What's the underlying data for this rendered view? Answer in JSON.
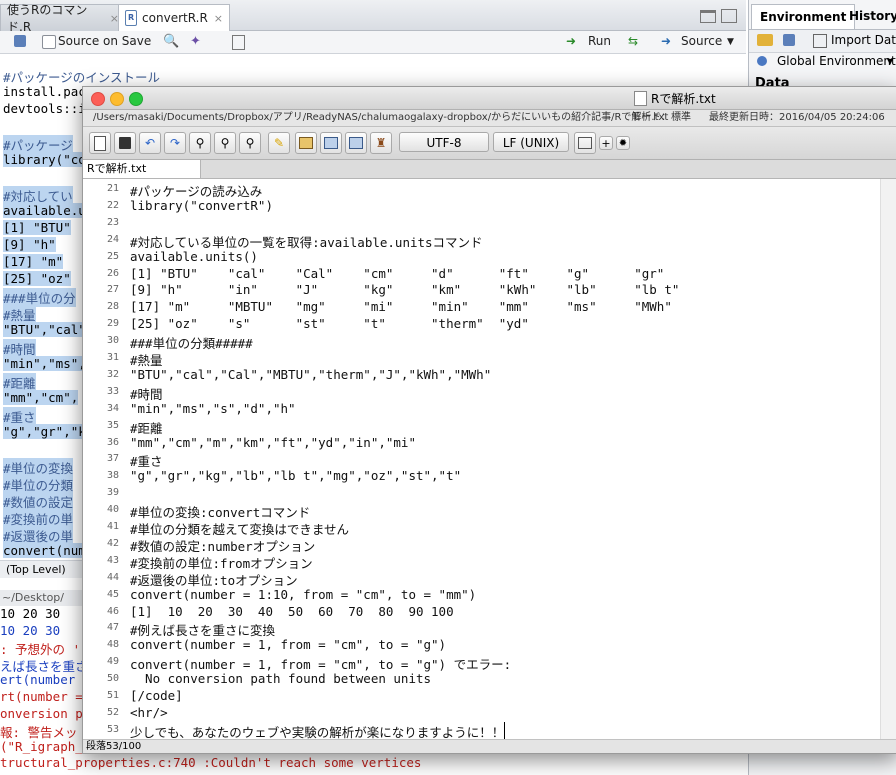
{
  "rstudio": {
    "tabs": [
      {
        "label": "使うRのコマンド.R",
        "close": "×"
      },
      {
        "label": "convertR.R",
        "close": "×"
      }
    ],
    "toolbar": {
      "source_on_save": "Source on Save",
      "run": "Run",
      "source": "Source"
    },
    "right_tabs": [
      "Environment",
      "History"
    ],
    "import_dataset": "Import Data",
    "global_env": "Global Environment",
    "data_label": "Data",
    "editor_lines": [
      "#パッケージのインストール",
      "install.pac",
      "devtools::i",
      "",
      "#パッケージ",
      "library(\"co",
      "",
      "#対応してい",
      "available.u",
      "[1] \"BTU\"",
      "[9] \"h\"",
      "[17] \"m\"",
      "[25] \"oz\"",
      "###単位の分",
      "#熱量",
      "\"BTU\",\"cal\"",
      "#時間",
      "\"min\",\"ms\",",
      "#距離",
      "\"mm\",\"cm\",",
      "#重さ",
      "\"g\",\"gr\",\"k",
      "",
      "#単位の変換",
      "#単位の分類",
      "#数値の設定",
      "#変換前の単",
      "#返還後の単",
      "convert(num"
    ],
    "status_level": "(Top Level)",
    "console_path": "~/Desktop/",
    "console_lines": [
      {
        "text": "10  20  30",
        "color": "#000000"
      },
      {
        "text": " 10  20  30",
        "color": "#1a3fbf"
      },
      {
        "text": ":  予想外の '",
        "color": "#c0201c"
      },
      {
        "text": "えば長さを重さに",
        "color": "#1a3fbf"
      },
      {
        "text": "ert(number =",
        "color": "#1a3fbf"
      },
      {
        "text": "rt(number =",
        "color": "#c0201c"
      },
      {
        "text": "onversion pa",
        "color": "#c0201c"
      },
      {
        "text": "報:  警告メッ",
        "color": "#c0201c"
      },
      {
        "text": "(\"R_igraph_g",
        "color": "#c0201c"
      },
      {
        "text": "tructural_properties.c:740 :Couldn't reach some vertices",
        "color": "#c0201c"
      }
    ]
  },
  "editor_window": {
    "title": "Rで解析.txt",
    "path": "/Users/masaki/Documents/Dropbox/アプリ/ReadyNAS/chalumaogalaxy-dropbox/からだにいいもの紹介記事/Rで解析.txt",
    "mode": "モード：標準",
    "last_modified": "最終更新日時：2016/04/05 20:24:06",
    "encoding": "UTF-8",
    "line_ending": "LF (UNIX)",
    "tab_label": "Rで解析.txt",
    "status": "段落53/100",
    "line_numbers": [
      "21",
      "22",
      "23",
      "24",
      "25",
      "26",
      "27",
      "28",
      "29",
      "30",
      "31",
      "32",
      "33",
      "34",
      "35",
      "36",
      "37",
      "38",
      "39",
      "40",
      "41",
      "42",
      "43",
      "44",
      "45",
      "46",
      "47",
      "48",
      "49",
      "50",
      "51",
      "52",
      "53"
    ],
    "lines": [
      "#パッケージの読み込み",
      "library(\"convertR\")",
      "",
      "#対応している単位の一覧を取得:available.unitsコマンド",
      "available.units()",
      "[1] \"BTU\"    \"cal\"    \"Cal\"    \"cm\"     \"d\"      \"ft\"     \"g\"      \"gr\"",
      "[9] \"h\"      \"in\"     \"J\"      \"kg\"     \"km\"     \"kWh\"    \"lb\"     \"lb t\"",
      "[17] \"m\"     \"MBTU\"   \"mg\"     \"mi\"     \"min\"    \"mm\"     \"ms\"     \"MWh\"",
      "[25] \"oz\"    \"s\"      \"st\"     \"t\"      \"therm\"  \"yd\"",
      "###単位の分類#####",
      "#熱量",
      "\"BTU\",\"cal\",\"Cal\",\"MBTU\",\"therm\",\"J\",\"kWh\",\"MWh\"",
      "#時間",
      "\"min\",\"ms\",\"s\",\"d\",\"h\"",
      "#距離",
      "\"mm\",\"cm\",\"m\",\"km\",\"ft\",\"yd\",\"in\",\"mi\"",
      "#重さ",
      "\"g\",\"gr\",\"kg\",\"lb\",\"lb t\",\"mg\",\"oz\",\"st\",\"t\"",
      "",
      "#単位の変換:convertコマンド",
      "#単位の分類を越えて変換はできません",
      "#数値の設定:numberオプション",
      "#変換前の単位:fromオプション",
      "#返還後の単位:toオプション",
      "convert(number = 1:10, from = \"cm\", to = \"mm\")",
      "[1]  10  20  30  40  50  60  70  80  90 100",
      "#例えば長さを重さに変換",
      "convert(number = 1, from = \"cm\", to = \"g\")",
      "convert(number = 1, from = \"cm\", to = \"g\") でエラー:",
      "  No conversion path found between units",
      "[/code]",
      "<hr/>",
      "少しでも、あなたのウェブや実験の解析が楽になりますように！！"
    ]
  },
  "colors": {
    "selection": "#bcd5f0",
    "console_error": "#c0201c",
    "console_blue": "#1a3fbf",
    "traffic_close": "#fc5f57",
    "traffic_min": "#fdbc2e",
    "traffic_max": "#28c840"
  }
}
